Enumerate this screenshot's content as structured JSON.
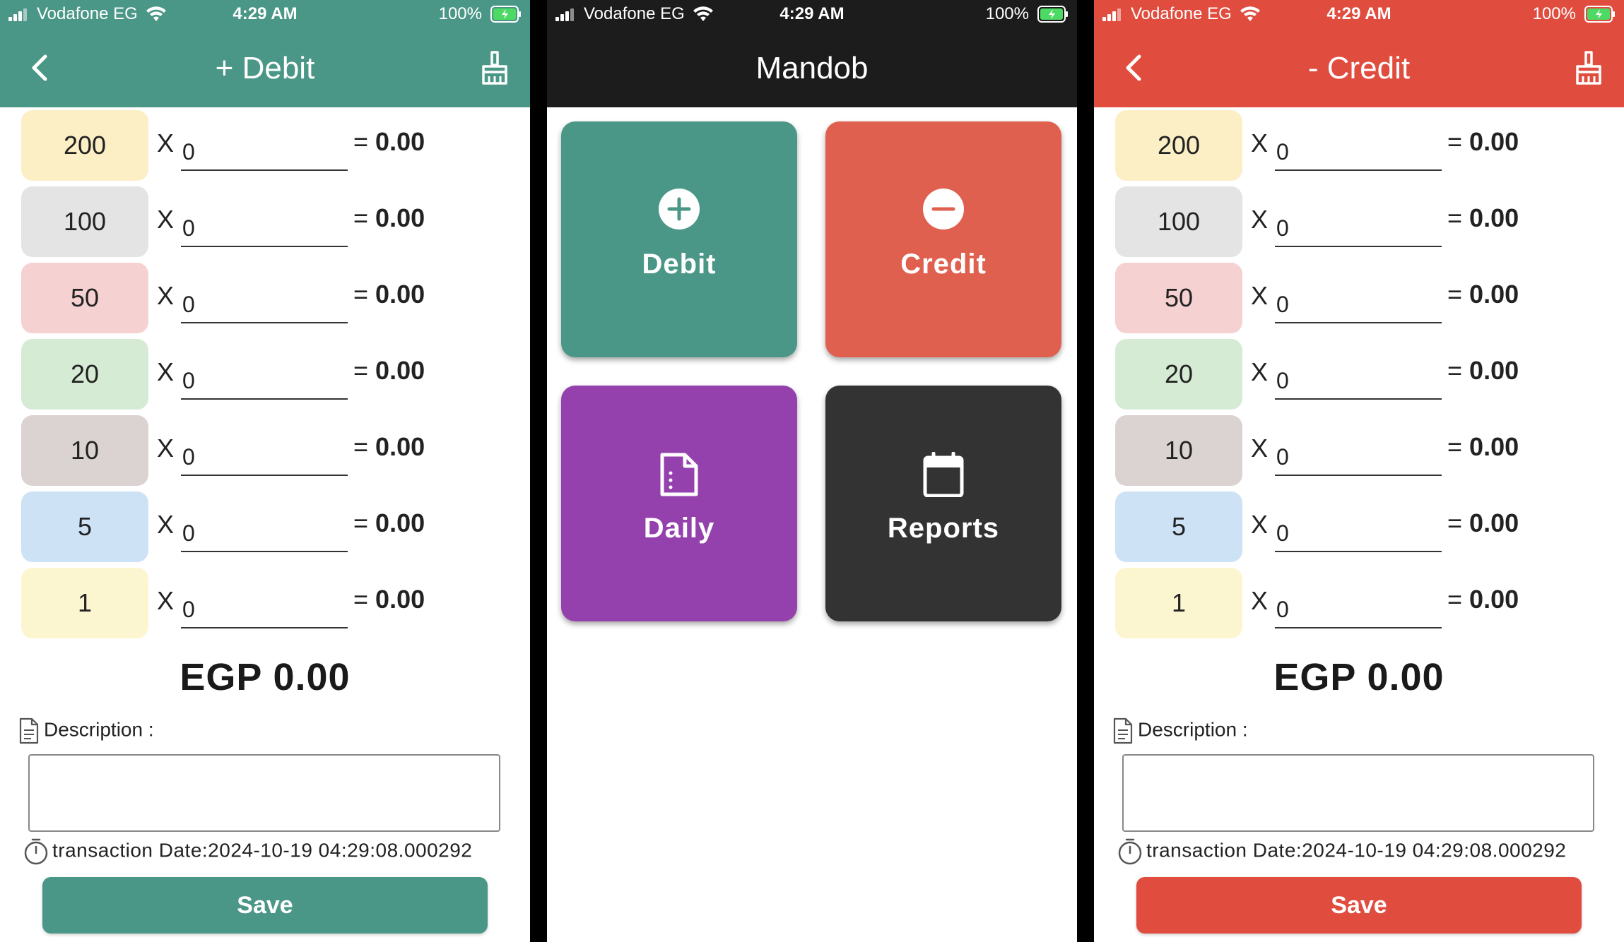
{
  "status_bar": {
    "carrier": "Vodafone EG",
    "time": "4:29 AM",
    "battery": "100%"
  },
  "colors": {
    "debit": "#4b9787",
    "credit": "#e04c3e",
    "home_header": "#1c1c1c",
    "tile_debit": "#4b9787",
    "tile_credit": "#e0604f",
    "tile_daily": "#9441ad",
    "tile_reports": "#333333"
  },
  "denominations": [
    {
      "label": "200",
      "color": "#fcefc5"
    },
    {
      "label": "100",
      "color": "#e4e4e4"
    },
    {
      "label": "50",
      "color": "#f5d1d1"
    },
    {
      "label": "20",
      "color": "#d5ebd4"
    },
    {
      "label": "10",
      "color": "#dbd3d1"
    },
    {
      "label": "5",
      "color": "#cee2f6"
    },
    {
      "label": "1",
      "color": "#fcf6d0"
    }
  ],
  "debit_screen": {
    "title": "+ Debit",
    "rows": [
      {
        "x": "X",
        "qty": "0",
        "eq": "=",
        "amount": "0.00"
      },
      {
        "x": "X",
        "qty": "0",
        "eq": "=",
        "amount": "0.00"
      },
      {
        "x": "X",
        "qty": "0",
        "eq": "=",
        "amount": "0.00"
      },
      {
        "x": "X",
        "qty": "0",
        "eq": "=",
        "amount": "0.00"
      },
      {
        "x": "X",
        "qty": "0",
        "eq": "=",
        "amount": "0.00"
      },
      {
        "x": "X",
        "qty": "0",
        "eq": "=",
        "amount": "0.00"
      },
      {
        "x": "X",
        "qty": "0",
        "eq": "=",
        "amount": "0.00"
      }
    ],
    "total": "EGP 0.00",
    "description_label": "Description :",
    "description_value": "",
    "transaction_date": "transaction Date:2024-10-19 04:29:08.000292",
    "save_label": "Save"
  },
  "home_screen": {
    "title": "Mandob",
    "tiles": [
      {
        "label": "Debit",
        "icon": "plus-circle-icon"
      },
      {
        "label": "Credit",
        "icon": "minus-circle-icon"
      },
      {
        "label": "Daily",
        "icon": "document-icon"
      },
      {
        "label": "Reports",
        "icon": "calendar-icon"
      }
    ]
  },
  "credit_screen": {
    "title": "- Credit",
    "rows": [
      {
        "x": "X",
        "qty": "0",
        "eq": "=",
        "amount": "0.00"
      },
      {
        "x": "X",
        "qty": "0",
        "eq": "=",
        "amount": "0.00"
      },
      {
        "x": "X",
        "qty": "0",
        "eq": "=",
        "amount": "0.00"
      },
      {
        "x": "X",
        "qty": "0",
        "eq": "=",
        "amount": "0.00"
      },
      {
        "x": "X",
        "qty": "0",
        "eq": "=",
        "amount": "0.00"
      },
      {
        "x": "X",
        "qty": "0",
        "eq": "=",
        "amount": "0.00"
      },
      {
        "x": "X",
        "qty": "0",
        "eq": "=",
        "amount": "0.00"
      }
    ],
    "total": "EGP 0.00",
    "description_label": "Description :",
    "description_value": "",
    "transaction_date": "transaction Date:2024-10-19 04:29:08.000292",
    "save_label": "Save"
  }
}
